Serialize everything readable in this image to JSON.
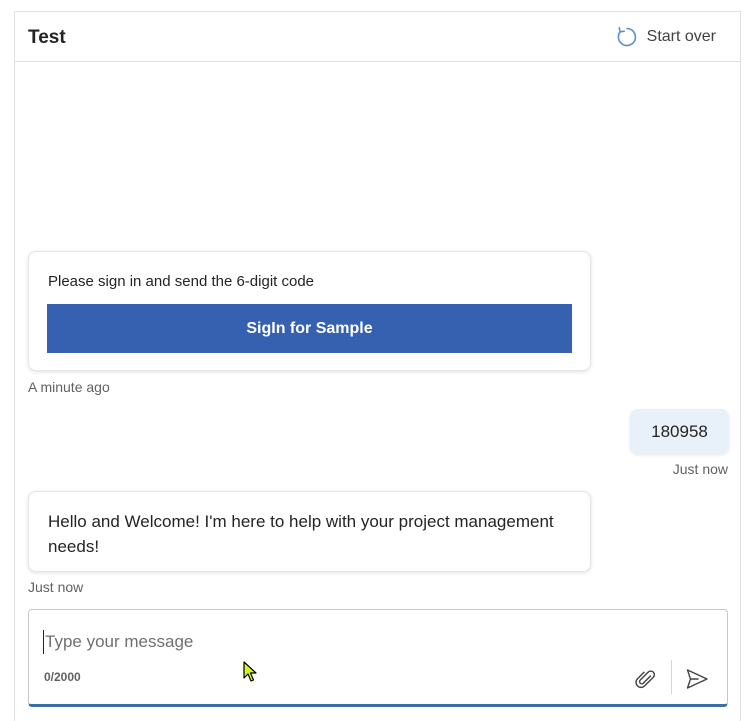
{
  "header": {
    "title": "Test",
    "restart_icon": "refresh-icon",
    "restart_label": "Start over"
  },
  "messages": [
    {
      "type": "bot-card",
      "text": "Please sign in and send the 6-digit code",
      "button_label": "SigIn for Sample",
      "timestamp": "A minute ago"
    },
    {
      "type": "user",
      "text": "180958",
      "timestamp": "Just now"
    },
    {
      "type": "bot",
      "text": "Hello and Welcome! I'm here to help with your project management needs!",
      "timestamp": "Just now"
    }
  ],
  "composer": {
    "placeholder": "Type your message",
    "value": "",
    "counter": "0/2000",
    "attach_icon": "paperclip-icon",
    "send_icon": "send-icon"
  },
  "colors": {
    "accent": "#3661b1",
    "user_bubble": "#e8f1fa",
    "focus_border": "#3a6ea5"
  }
}
